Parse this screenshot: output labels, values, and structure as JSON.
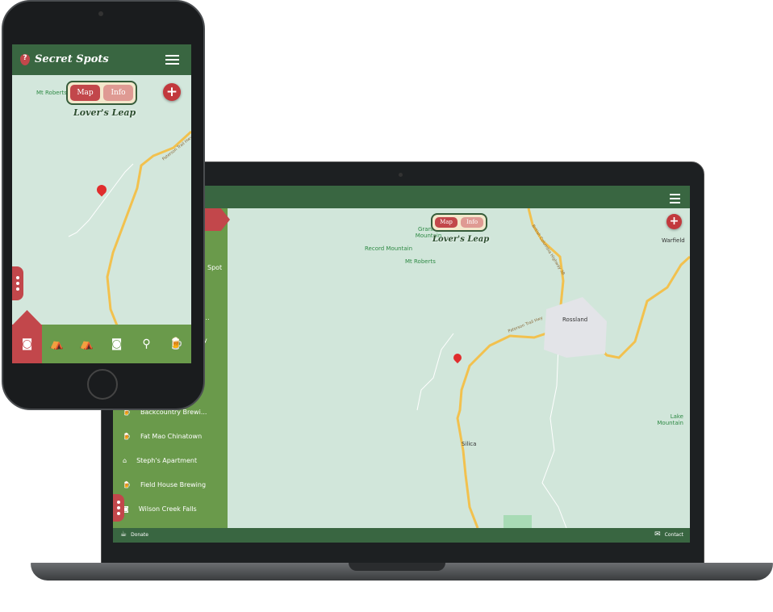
{
  "app": {
    "title": "Secret Spots",
    "logo_glyph": "?"
  },
  "toggle": {
    "map": "Map",
    "info": "Info"
  },
  "spot_title": "Lover's Leap",
  "add_label": "+",
  "laptop": {
    "partial_items": [
      "Spot",
      "...",
      "y"
    ],
    "sidebar_items": [
      {
        "icon": "beer-icon",
        "glyph": "🍺",
        "label": "Backcountry Brewi..."
      },
      {
        "icon": "beer-icon",
        "glyph": "🍺",
        "label": "Fat Mao Chinatown"
      },
      {
        "icon": "house-icon",
        "glyph": "⌂",
        "label": "Steph's Apartment"
      },
      {
        "icon": "beer-icon",
        "glyph": "🍺",
        "label": "Field House Brewing"
      },
      {
        "icon": "camera-icon",
        "glyph": "◙",
        "label": "Wilson Creek Falls"
      }
    ],
    "footer": {
      "donate": "Donate",
      "contact": "Contact"
    },
    "map_labels": {
      "record": "Record Mountain",
      "granite": "Granite Mountain",
      "roberts": "Mt Roberts",
      "rossland": "Rossland",
      "warfield": "Warfield",
      "silica": "Silica",
      "lake": "Lake Mountain",
      "hwy": "22",
      "hwy2": "3B",
      "road1": "Paterson Trail Hwy",
      "road2": "British Columbia Highway 3B"
    }
  },
  "phone": {
    "map_labels": {
      "roberts": "Mt Roberts",
      "road": "Paterson Trail Hwy",
      "hwy": "22"
    },
    "footer_icons": [
      {
        "icon": "camera-icon",
        "glyph": "◙",
        "active": true
      },
      {
        "icon": "tent-icon",
        "glyph": "⛺"
      },
      {
        "icon": "tent-icon",
        "glyph": "⛺"
      },
      {
        "icon": "camera-icon",
        "glyph": "◙"
      },
      {
        "icon": "fishing-hook-icon",
        "glyph": "⚲"
      },
      {
        "icon": "beer-icon",
        "glyph": "🍺"
      }
    ]
  },
  "colors": {
    "header": "#396641",
    "sidebar": "#6a9a4b",
    "accent": "#c2474b",
    "map": "#d1e6da"
  }
}
